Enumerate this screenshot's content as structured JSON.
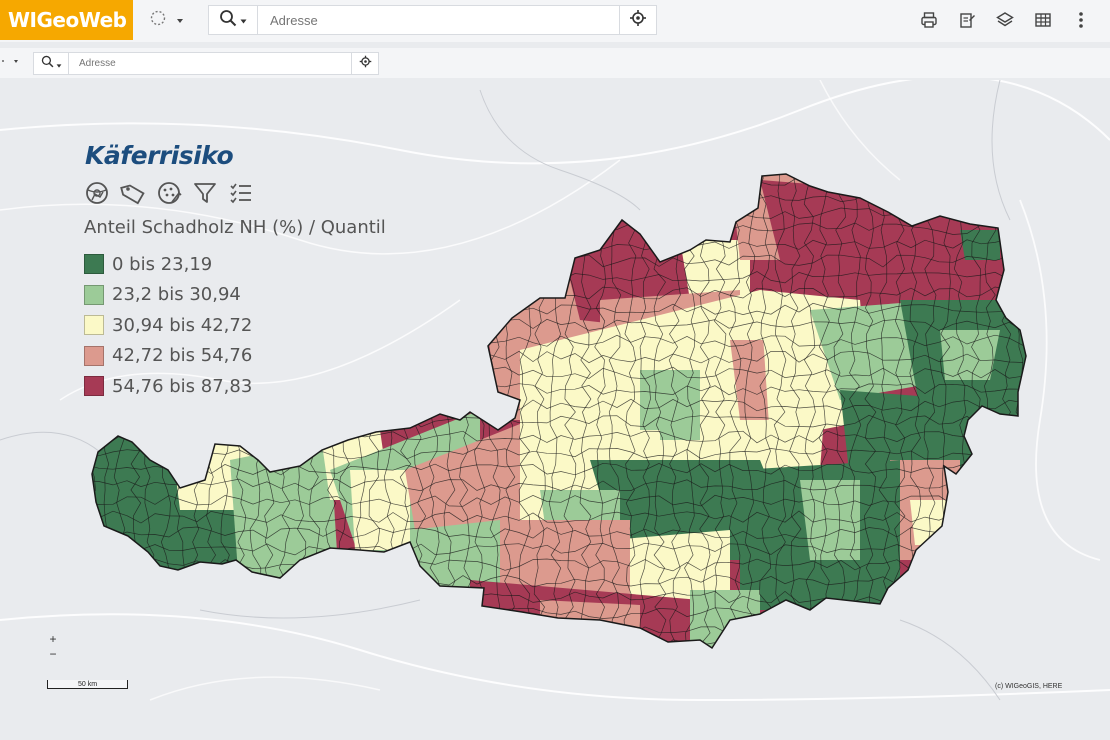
{
  "app": {
    "logo_text": "WIGeoWeb"
  },
  "toolbar": {
    "search_placeholder": "Adresse",
    "icons": [
      "selection-circle-icon",
      "search-icon",
      "crosshair-icon",
      "print-icon",
      "edit-document-icon",
      "layers-icon",
      "table-icon",
      "more-vertical-icon"
    ]
  },
  "subbar": {
    "search_placeholder": "Adresse"
  },
  "legend": {
    "title": "Käferrisiko",
    "subtitle": "Anteil Schadholz NH (%) / Quantil",
    "classes": [
      {
        "label": "0 bis 23,19",
        "color": "#3d7a52"
      },
      {
        "label": "23,2 bis 30,94",
        "color": "#9ccb98"
      },
      {
        "label": "30,94 bis 42,72",
        "color": "#fbf9c7"
      },
      {
        "label": "42,72 bis 54,76",
        "color": "#dc9a8e"
      },
      {
        "label": "54,76 bis 87,83",
        "color": "#a63a55"
      }
    ],
    "tool_icons": [
      "globe-gear-icon",
      "tag-icon",
      "dotted-circle-icon",
      "filter-icon",
      "list-settings-icon"
    ]
  },
  "map": {
    "zoom_in": "+",
    "zoom_out": "−",
    "scale_label": "50 km",
    "attribution": "(c) WIGeoGIS, HERE",
    "background_color": "#e9ebee",
    "border_color": "#1a1a1a"
  }
}
